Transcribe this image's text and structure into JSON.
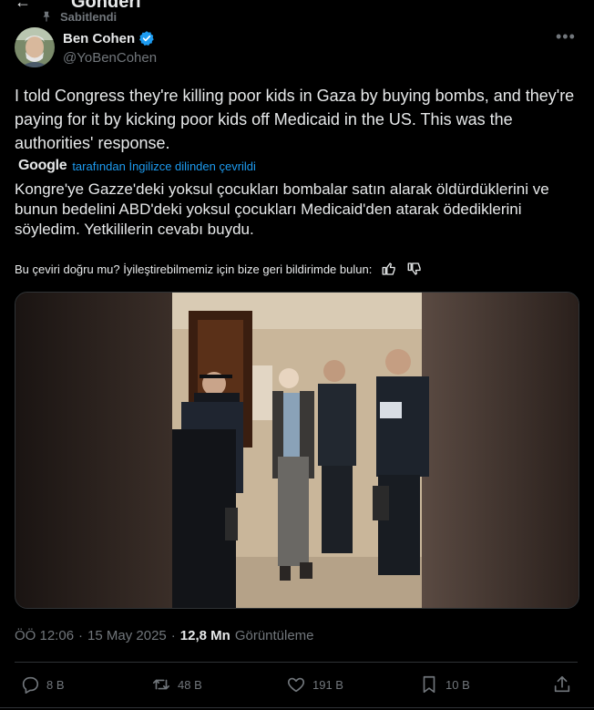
{
  "header": {
    "back_icon": "back-arrow-icon",
    "title": "Gönderi"
  },
  "pinned": {
    "label": "Sabitlendi",
    "icon": "pin-icon"
  },
  "author": {
    "display_name": "Ben Cohen",
    "handle": "@YoBenCohen",
    "verified": true,
    "verified_color": "#1d9bf0"
  },
  "more_icon": "more-icon",
  "tweet": {
    "text": "I told Congress they're killing poor kids in Gaza by buying bombs, and they're paying for it by kicking poor kids off Medicaid in the US. This was the authorities' response.",
    "translation_provider": "Google",
    "translation_note": "tarafından İngilizce dilinden çevrildi",
    "translated_text": "Kongre'ye Gazze'deki yoksul çocukları bombalar satın alarak öldürdüklerini ve bunun bedelini ABD'deki yoksul çocukları Medicaid'den atarak ödediklerini söyledim. Yetkililerin cevabı buydu.",
    "feedback_prompt": "Bu çeviri doğru mu? İyileştirebilmemiz için bize geri bildirimde bulun:"
  },
  "meta": {
    "time": "ÖÖ 12:06",
    "date": "15 May 2025",
    "views": "12,8 Mn",
    "views_label": "Görüntüleme"
  },
  "actions": [
    {
      "icon": "reply-icon",
      "count": "8 B"
    },
    {
      "icon": "retweet-icon",
      "count": "48 B"
    },
    {
      "icon": "like-icon",
      "count": "191 B"
    },
    {
      "icon": "bookmark-icon",
      "count": "10 B"
    },
    {
      "icon": "share-icon",
      "count": ""
    }
  ],
  "colors": {
    "background": "#000000",
    "text": "#e7e9ea",
    "secondary": "#71767b",
    "accent": "#1d9bf0",
    "border": "#2f3336"
  }
}
